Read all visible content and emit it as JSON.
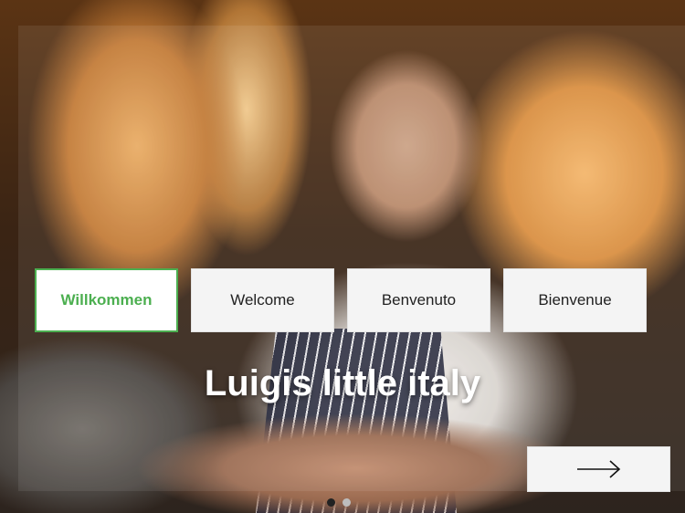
{
  "background": {
    "photo_description": "Chef in apron standing in an Italian deli"
  },
  "languages": [
    {
      "label": "Willkommen",
      "active": true
    },
    {
      "label": "Welcome",
      "active": false
    },
    {
      "label": "Benvenuto",
      "active": false
    },
    {
      "label": "Bienvenue",
      "active": false
    }
  ],
  "title": "Luigis little italy",
  "next_button": {
    "icon": "arrow-right-icon"
  },
  "pagination": {
    "current": 1,
    "total": 2
  },
  "colors": {
    "accent": "#4caf50",
    "button_bg": "#f4f4f4",
    "title_text": "#ffffff"
  }
}
